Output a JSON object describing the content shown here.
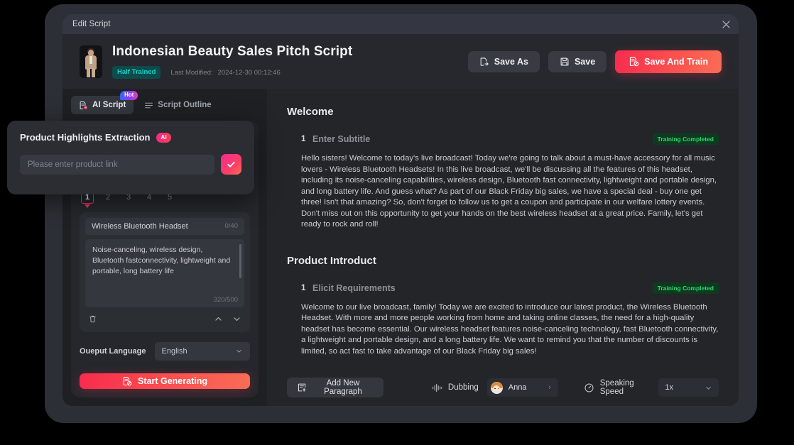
{
  "window": {
    "titlebar_label": "Edit Script",
    "close_icon": "close-icon"
  },
  "header": {
    "script_title": "Indonesian Beauty Sales Pitch Script",
    "status_badge": "Half Trained",
    "last_modified_label": "Last Modified:",
    "last_modified_value": "2024-12-30 00:12:46",
    "buttons": [
      {
        "label": "Save As",
        "icon": "save-as-icon",
        "style": "dark"
      },
      {
        "label": "Save",
        "icon": "save-icon",
        "style": "dark"
      },
      {
        "label": "Save And Train",
        "icon": "save-train-icon",
        "style": "primary"
      }
    ]
  },
  "sidebar": {
    "tabs": [
      {
        "label": "AI Script",
        "icon": "ai-script-icon",
        "active": true,
        "badge": "Hot"
      },
      {
        "label": "Script Outline",
        "icon": "outline-icon",
        "active": false
      }
    ],
    "pager": [
      "1",
      "2",
      "3",
      "4",
      "5"
    ],
    "pager_active": "1",
    "product": {
      "name": "Wireless Bluetooth Headset",
      "name_count": "0/40",
      "description": "Noise-canceling, wireless design, Bluetooth fastconnectivity, lightweight and portable, long battery life",
      "description_count": "320/500",
      "delete_icon": "trash-icon",
      "up_icon": "chevron-up-icon",
      "down_icon": "chevron-down-icon"
    },
    "language_label": "Oueput Language",
    "language_value": "English",
    "generate_label": "Start Generating",
    "generate_icon": "generate-icon"
  },
  "popup": {
    "title": "Product Highlights Extraction",
    "ai_badge": "AI",
    "input_value": "",
    "input_placeholder": "Please enter product link",
    "confirm_icon": "check-icon"
  },
  "main": {
    "sections": [
      {
        "title": "Welcome",
        "paragraphs": [
          {
            "index": "1",
            "subtitle": "Enter Subtitle",
            "status": "Training Completed",
            "body": "Hello sisters! Welcome to today's live broadcast! Today we're going to talk about a must-have accessory for all music lovers - Wireless Bluetooth Headsets! In this live broadcast, we'll be discussing all the features of this headset, including its noise-canceling capabilities, wireless design, Bluetooth fast connectivity, lightweight and portable design, and long battery life. And guess what? As part of our Black Friday big sales, we have a special deal - buy one get three! Isn't that amazing? So, don't forget to follow us to get a coupon and participate in our welfare lottery events. Don't miss out on this opportunity to get your hands on the best wireless headset at a great price. Family, let's get ready to rock and roll!"
          }
        ]
      },
      {
        "title": "Product Introduct",
        "paragraphs": [
          {
            "index": "1",
            "subtitle": "Elicit Requirements",
            "status": "Training Completed",
            "body": "Welcome to our live broadcast, family! Today we are excited to introduce our latest product, the Wireless Bluetooth Headset. With more and more people working from home and taking online classes, the need for a high-quality headset has become essential. Our wireless headset features noise-canceling technology, fast Bluetooth connectivity, a lightweight and portable design, and a long battery life. We want to remind you that the number of discounts is limited, so act fast to take advantage of our Black Friday big sales!"
          }
        ]
      }
    ],
    "bottom": {
      "add_paragraph_label": "Add New Paragraph",
      "add_paragraph_icon": "add-paragraph-icon",
      "dubbing_label": "Dubbing",
      "dubbing_icon": "waveform-icon",
      "voice_name": "Anna",
      "voice_chevron": "›",
      "speed_label": "Speaking Speed",
      "speed_icon": "gauge-icon",
      "speed_value": "1x"
    }
  },
  "colors": {
    "accent_red": "#f82b4f",
    "accent_pink": "#f62a8e",
    "teal_badge": "#19d4c8",
    "green_badge": "#2fd66f",
    "hot_gradient_start": "#2f6bff",
    "hot_gradient_end": "#e63fb0"
  }
}
